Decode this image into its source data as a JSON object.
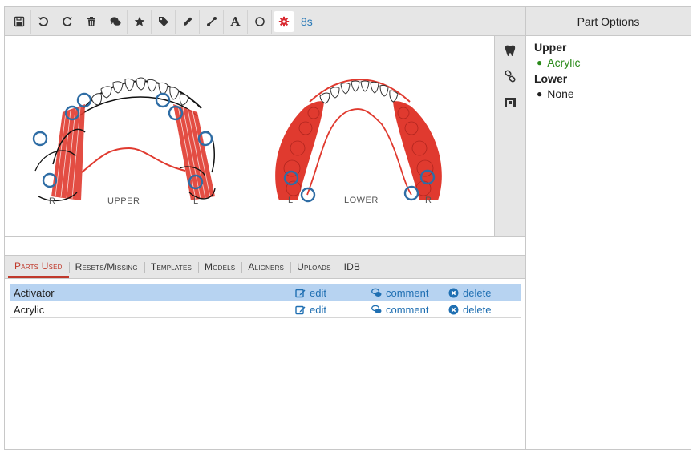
{
  "toolbar": {
    "tools": [
      "save-icon",
      "undo-icon",
      "redo-icon",
      "trash-icon",
      "comments-icon",
      "star-icon",
      "tag-icon",
      "pencil-icon",
      "line-icon",
      "text-icon",
      "circle-icon",
      "gear-icon"
    ],
    "text_tool_label": "A",
    "timer": "8s"
  },
  "canvas": {
    "upper_label": "UPPER",
    "lower_label": "LOWER",
    "upper_left_side": "R",
    "upper_right_side": "L",
    "lower_left_side": "L",
    "lower_right_side": "R",
    "accent_red": "#e03a2f",
    "marker_blue": "#2f6da5"
  },
  "side_tools": [
    "tooth-icon",
    "link-icon",
    "bracket-icon"
  ],
  "tabs": [
    {
      "label": "Parts Used",
      "active": true
    },
    {
      "label": "Resets/Missing"
    },
    {
      "label": "Templates"
    },
    {
      "label": "Models"
    },
    {
      "label": "Aligners"
    },
    {
      "label": "Uploads"
    },
    {
      "label": "IDB"
    }
  ],
  "parts": [
    {
      "name": "Activator",
      "selected": true,
      "edit": "edit",
      "comment": "comment",
      "delete": "delete"
    },
    {
      "name": "Acrylic",
      "selected": false,
      "edit": "edit",
      "comment": "comment",
      "delete": "delete"
    }
  ],
  "part_options": {
    "title": "Part Options",
    "upper": {
      "label": "Upper",
      "items": [
        "Acrylic"
      ]
    },
    "lower": {
      "label": "Lower",
      "items": [
        "None"
      ]
    }
  }
}
